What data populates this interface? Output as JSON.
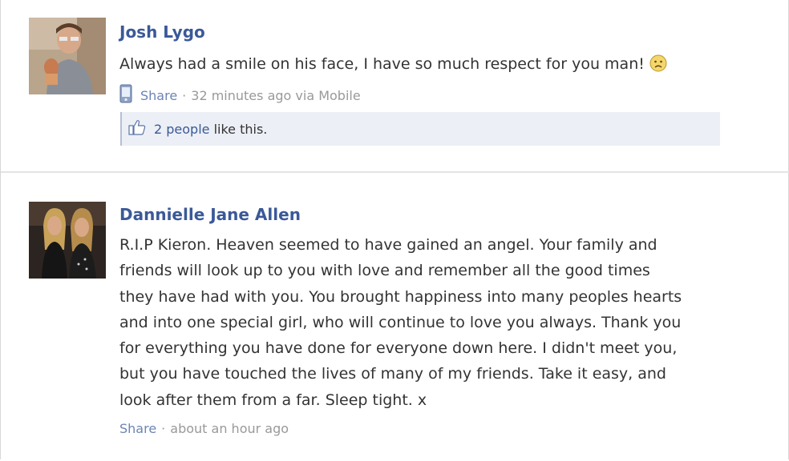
{
  "posts": [
    {
      "author": "Josh Lygo",
      "text": "Always had a smile on his face, I have so much respect for you man!",
      "emoticon": "sad-face-icon",
      "share_label": "Share",
      "separator": "·",
      "time_text": "32 minutes ago via Mobile",
      "likes_count": "2 people",
      "likes_suffix": "like this."
    },
    {
      "author": "Dannielle Jane Allen",
      "text": "R.I.P Kieron. Heaven seemed to have gained an angel. Your family and\nfriends will look up to you with love and remember all the good times\nthey have had with you. You brought happiness into many peoples hearts\nand into one special girl, who will continue to love you always. Thank you\nfor everything you have done for everyone down here. I didn't meet you,\nbut you have touched the lives of many of my friends. Take it easy, and\nlook after them from a far. Sleep tight. x",
      "share_label": "Share",
      "separator": "·",
      "time_text": "about an hour ago"
    }
  ],
  "colors": {
    "author": "#3b5998",
    "link": "#6d84b4",
    "meta": "#999999",
    "likes_bg": "#eceff5"
  }
}
